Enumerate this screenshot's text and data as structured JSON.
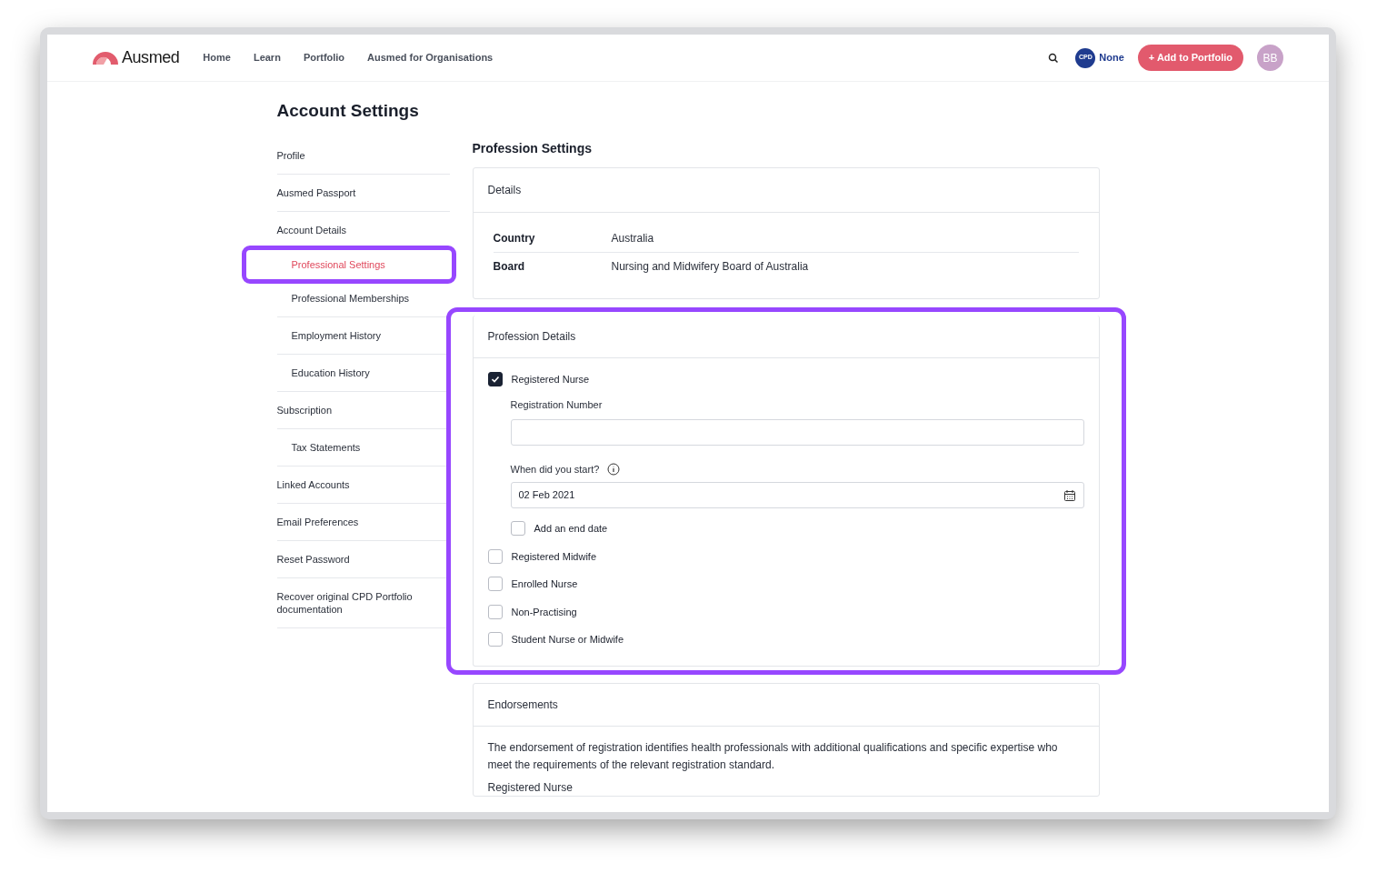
{
  "nav": {
    "logo": "Ausmed",
    "links": [
      "Home",
      "Learn",
      "Portfolio",
      "Ausmed for Organisations"
    ],
    "cpd_badge": "CPD",
    "cpd_status": "None",
    "add_button": "+ Add to Portfolio",
    "avatar": "BB"
  },
  "page_title": "Account Settings",
  "sidebar": [
    {
      "label": "Profile",
      "selected": false,
      "highlighted": false
    },
    {
      "label": "Ausmed Passport",
      "selected": false,
      "highlighted": false
    },
    {
      "label": "Account Details",
      "selected": false,
      "highlighted": false,
      "children": [
        {
          "label": "Professional Settings",
          "selected": true,
          "highlighted": true
        },
        {
          "label": "Professional Memberships",
          "selected": false,
          "highlighted": false
        },
        {
          "label": "Employment History",
          "selected": false,
          "highlighted": false
        },
        {
          "label": "Education History",
          "selected": false,
          "highlighted": false
        }
      ]
    },
    {
      "label": "Subscription",
      "selected": false,
      "highlighted": false,
      "children": [
        {
          "label": "Tax Statements",
          "selected": false,
          "highlighted": false
        }
      ]
    },
    {
      "label": "Linked Accounts",
      "selected": false,
      "highlighted": false
    },
    {
      "label": "Email Preferences",
      "selected": false,
      "highlighted": false
    },
    {
      "label": "Reset Password",
      "selected": false,
      "highlighted": false
    },
    {
      "label": "Recover original CPD Portfolio documentation",
      "selected": false,
      "highlighted": false
    }
  ],
  "section_title": "Profession Settings",
  "details": {
    "title": "Details",
    "rows": [
      {
        "label": "Country",
        "value": "Australia"
      },
      {
        "label": "Board",
        "value": "Nursing and Midwifery Board of Australia"
      }
    ]
  },
  "profession_details": {
    "title": "Profession Details",
    "highlighted": true,
    "professions": [
      {
        "label": "Registered Nurse",
        "checked": true,
        "registration_label": "Registration Number",
        "start_label": "When did you start?",
        "start_value": "02 Feb 2021",
        "end_date_label": "Add an end date",
        "end_date_checked": false
      },
      {
        "label": "Registered Midwife",
        "checked": false
      },
      {
        "label": "Enrolled Nurse",
        "checked": false
      },
      {
        "label": "Non-Practising",
        "checked": false
      },
      {
        "label": "Student Nurse or Midwife",
        "checked": false
      }
    ]
  },
  "endorsements": {
    "title": "Endorsements",
    "text": "The endorsement of registration identifies health professionals with additional qualifications and specific expertise who meet the requirements of the relevant registration standard.",
    "subheading": "Registered Nurse"
  }
}
